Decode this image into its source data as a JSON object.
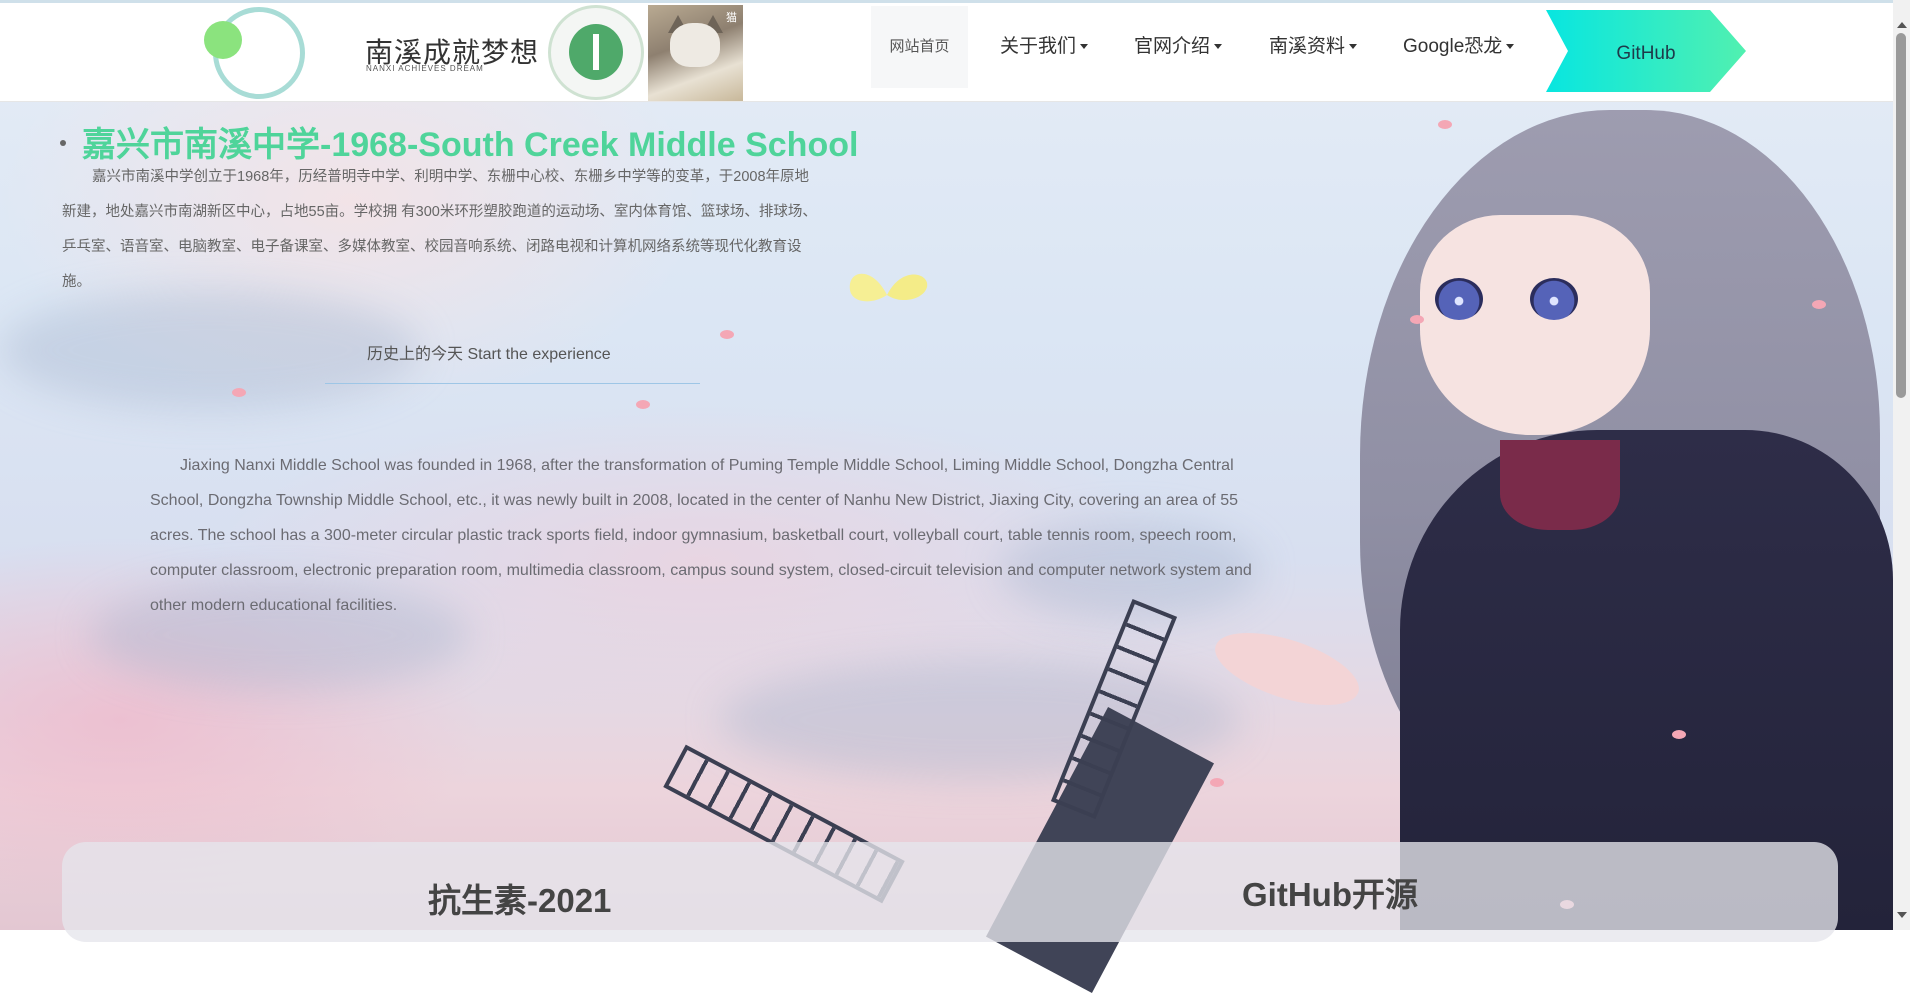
{
  "header": {
    "brand_text": "南溪成就梦想",
    "brand_sub": "NANXI ACHIEVES DREAM",
    "cat_mark": "猫",
    "nav": {
      "home": "网站首页",
      "items": [
        "关于我们",
        "官网介绍",
        "南溪资料",
        "Google恐龙"
      ],
      "github": "GitHub"
    }
  },
  "hero": {
    "title": "嘉兴市南溪中学-1968-South Creek Middle School",
    "intro_cn": "嘉兴市南溪中学创立于1968年，历经普明寺中学、利明中学、东栅中心校、东栅乡中学等的变革，于2008年原地新建，地处嘉兴市南湖新区中心，占地55亩。学校拥 有300米环形塑胶跑道的运动场、室内体育馆、篮球场、排球场、 乒乓室、语音室、电脑教室、电子备课室、多媒体教室、校园音响系统、闭路电视和计算机网络系统等现代化教育设施。",
    "history_link": "历史上的今天 Start the experience",
    "intro_en": "Jiaxing Nanxi Middle School was founded in 1968, after the transformation of Puming Temple Middle School, Liming Middle School, Dongzha Central School, Dongzha Township Middle School, etc., it was newly built in 2008, located in the center of Nanhu New District, Jiaxing City, covering an area of 55 acres. The school has a 300-meter circular plastic track sports field, indoor gymnasium, basketball court, volleyball court, table tennis room, speech room, computer classroom, electronic preparation room, multimedia classroom, campus sound system, closed-circuit television and computer network system and other modern educational facilities."
  },
  "cards": {
    "left_title": "抗生素-2021",
    "right_title": "GitHub开源"
  },
  "colors": {
    "title_green": "#4fd49a",
    "github_gradient_start": "#08e6e0",
    "github_gradient_end": "#51f0b0"
  }
}
